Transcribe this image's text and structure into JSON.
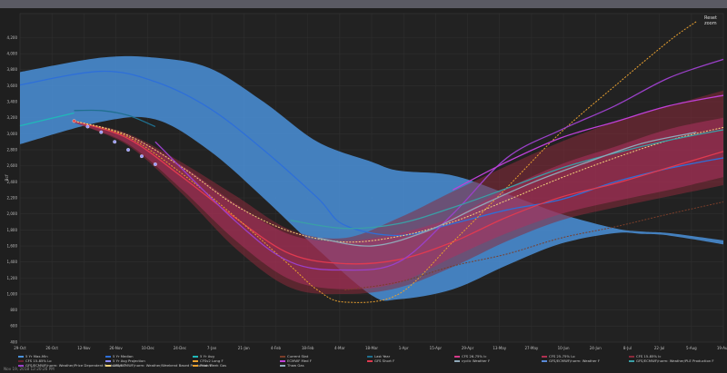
{
  "chart_data": {
    "type": "area",
    "ylabel": "Bcf",
    "y_ticks": [
      "400",
      "600",
      "800",
      "1,000",
      "1,200",
      "1,400",
      "1,600",
      "1,800",
      "2,000",
      "2,200",
      "2,400",
      "2,600",
      "2,800",
      "3,000",
      "3,200",
      "3,400",
      "3,600",
      "3,800",
      "4,000",
      "4,200"
    ],
    "x_ticks": [
      "29-Oct",
      "26-Oct",
      "12-Nov",
      "26-Nov",
      "10-Dec",
      "24-Dec",
      "7-Jan",
      "21-Jan",
      "4-Feb",
      "18-Feb",
      "4-Mar",
      "18-Mar",
      "1-Apr",
      "15-Apr",
      "29-Apr",
      "13-May",
      "27-May",
      "10-Jun",
      "24-Jun",
      "8-Jul",
      "22-Jul",
      "5-Aug",
      "19-Aug"
    ],
    "reset_zoom_label": "Reset zoom",
    "footer_text": "Nov 19, 2018 12:20:26 PM",
    "series": [
      {
        "name": "5 Yr Max-Min",
        "color": "#4a90d9",
        "kind": "band",
        "upper": [
          [
            0,
            3770
          ],
          [
            3,
            3950
          ],
          [
            5,
            3950
          ],
          [
            7,
            3820
          ],
          [
            9,
            3400
          ],
          [
            11,
            2900
          ],
          [
            13,
            2650
          ],
          [
            14,
            2540
          ],
          [
            16,
            2480
          ],
          [
            18,
            2250
          ],
          [
            20,
            2000
          ],
          [
            22,
            1820
          ],
          [
            23,
            1780
          ],
          [
            24,
            1760
          ],
          [
            26,
            1670
          ]
        ],
        "lower": [
          [
            0,
            2870
          ],
          [
            3,
            3150
          ],
          [
            5,
            3180
          ],
          [
            7,
            2790
          ],
          [
            9,
            2200
          ],
          [
            11,
            1560
          ],
          [
            13,
            985
          ],
          [
            14,
            935
          ],
          [
            16,
            1060
          ],
          [
            18,
            1360
          ],
          [
            20,
            1630
          ],
          [
            22,
            1760
          ],
          [
            23,
            1750
          ],
          [
            24,
            1730
          ],
          [
            26,
            1620
          ]
        ]
      },
      {
        "name": "5 Yr Avg",
        "color": "#2e6fd8",
        "points": [
          [
            0,
            3610
          ],
          [
            3,
            3780
          ],
          [
            5,
            3650
          ],
          [
            7,
            3320
          ],
          [
            9,
            2800
          ],
          [
            11,
            2200
          ],
          [
            12,
            1860
          ],
          [
            14,
            1730
          ],
          [
            16,
            1880
          ],
          [
            18,
            2050
          ],
          [
            20,
            2180
          ],
          [
            22,
            2400
          ],
          [
            24,
            2570
          ],
          [
            26,
            2700
          ]
        ]
      },
      {
        "name": "Last Year",
        "color": "#20b8b8",
        "points": [
          [
            0,
            3100
          ],
          [
            2,
            3260
          ]
        ]
      },
      {
        "name": "Current Year",
        "color": "#1f6f8f",
        "points": [
          [
            2,
            3290
          ],
          [
            3,
            3290
          ],
          [
            4,
            3230
          ],
          [
            5,
            3090
          ]
        ]
      },
      {
        "name": "CFS 26-75% Ic",
        "color": "#d63a8a",
        "kind": "band",
        "upper": [
          [
            2,
            3160
          ],
          [
            4,
            2980
          ],
          [
            6,
            2600
          ],
          [
            8,
            2120
          ],
          [
            10,
            1740
          ],
          [
            12,
            1660
          ],
          [
            14,
            1760
          ],
          [
            16,
            1960
          ],
          [
            18,
            2320
          ],
          [
            20,
            2620
          ],
          [
            22,
            2840
          ],
          [
            24,
            3060
          ],
          [
            26,
            3200
          ]
        ],
        "lower": [
          [
            2,
            3140
          ],
          [
            4,
            2870
          ],
          [
            6,
            2300
          ],
          [
            8,
            1660
          ],
          [
            10,
            1180
          ],
          [
            12,
            1060
          ],
          [
            14,
            1140
          ],
          [
            16,
            1460
          ],
          [
            18,
            1760
          ],
          [
            20,
            2000
          ],
          [
            22,
            2160
          ],
          [
            24,
            2300
          ],
          [
            26,
            2460
          ]
        ]
      },
      {
        "name": "CFS 15-85% Lo",
        "color": "#8b2a3a",
        "kind": "band",
        "upper": [
          [
            2,
            3160
          ],
          [
            4,
            3000
          ],
          [
            6,
            2640
          ],
          [
            8,
            2220
          ],
          [
            10,
            1800
          ],
          [
            12,
            1700
          ],
          [
            14,
            1950
          ],
          [
            16,
            2280
          ],
          [
            18,
            2600
          ],
          [
            20,
            2900
          ],
          [
            22,
            3150
          ],
          [
            24,
            3350
          ],
          [
            26,
            3540
          ]
        ],
        "lower": [
          [
            2,
            3140
          ],
          [
            4,
            2850
          ],
          [
            6,
            2250
          ],
          [
            8,
            1560
          ],
          [
            10,
            1080
          ],
          [
            12,
            1000
          ],
          [
            14,
            1080
          ],
          [
            16,
            1340
          ],
          [
            18,
            1660
          ],
          [
            20,
            1920
          ],
          [
            22,
            2080
          ],
          [
            24,
            2220
          ],
          [
            26,
            2360
          ]
        ]
      },
      {
        "name": "CFS Med",
        "color": "#e03a50",
        "points": [
          [
            2,
            3160
          ],
          [
            4,
            2940
          ],
          [
            6,
            2460
          ],
          [
            8,
            1940
          ],
          [
            10,
            1500
          ],
          [
            12,
            1380
          ],
          [
            14,
            1430
          ],
          [
            16,
            1650
          ],
          [
            18,
            1960
          ],
          [
            20,
            2210
          ],
          [
            22,
            2380
          ],
          [
            24,
            2580
          ],
          [
            26,
            2780
          ]
        ]
      },
      {
        "name": "CFSv2 Long",
        "color": "#e8a030",
        "points": [
          [
            2,
            3160
          ],
          [
            4,
            2960
          ],
          [
            6,
            2500
          ],
          [
            8,
            1950
          ],
          [
            10,
            1350
          ],
          [
            11,
            1050
          ],
          [
            12,
            900
          ],
          [
            14,
            1000
          ],
          [
            16,
            1650
          ],
          [
            18,
            2330
          ],
          [
            20,
            3020
          ],
          [
            22,
            3600
          ],
          [
            24,
            4160
          ],
          [
            25,
            4400
          ]
        ]
      },
      {
        "name": "Weather",
        "color": "#f2d27a",
        "points": [
          [
            2,
            3160
          ],
          [
            4,
            2980
          ],
          [
            6,
            2580
          ],
          [
            8,
            2100
          ],
          [
            10,
            1780
          ],
          [
            12,
            1650
          ],
          [
            14,
            1720
          ],
          [
            16,
            1900
          ],
          [
            18,
            2170
          ],
          [
            20,
            2450
          ],
          [
            22,
            2700
          ],
          [
            24,
            2920
          ],
          [
            26,
            3080
          ]
        ]
      },
      {
        "name": "Price Dependent Production",
        "color": "#9a40c8",
        "points": [
          [
            5,
            2900
          ],
          [
            8,
            1900
          ],
          [
            10,
            1400
          ],
          [
            12,
            1300
          ],
          [
            14,
            1400
          ],
          [
            16,
            2000
          ],
          [
            18,
            2700
          ],
          [
            20,
            3050
          ],
          [
            22,
            3350
          ],
          [
            24,
            3700
          ],
          [
            26,
            3930
          ]
        ]
      },
      {
        "name": "Current Stat",
        "color": "#7a3e2a",
        "points": [
          [
            12,
            1050
          ],
          [
            14,
            1150
          ],
          [
            16,
            1350
          ],
          [
            18,
            1500
          ],
          [
            20,
            1700
          ],
          [
            22,
            1840
          ],
          [
            24,
            2000
          ],
          [
            26,
            2150
          ]
        ]
      },
      {
        "name": "ECMWF Med",
        "color": "#c040d8",
        "points": [
          [
            16,
            2300
          ],
          [
            18,
            2650
          ],
          [
            20,
            2950
          ],
          [
            22,
            3150
          ],
          [
            24,
            3350
          ],
          [
            26,
            3480
          ]
        ]
      },
      {
        "name": "WeatherTX Production",
        "color": "#3a9fa6",
        "points": [
          [
            10,
            1920
          ],
          [
            12,
            1820
          ],
          [
            14,
            1880
          ],
          [
            16,
            2080
          ],
          [
            18,
            2320
          ],
          [
            20,
            2570
          ],
          [
            22,
            2760
          ],
          [
            24,
            2920
          ],
          [
            26,
            3050
          ]
        ]
      },
      {
        "name": "Thaw Gas",
        "color": "#90a8b8",
        "points": [
          [
            11,
            1700
          ],
          [
            13,
            1600
          ],
          [
            15,
            1780
          ],
          [
            17,
            2100
          ],
          [
            19,
            2400
          ],
          [
            21,
            2650
          ],
          [
            23,
            2880
          ],
          [
            25,
            3020
          ]
        ]
      }
    ],
    "markers": {
      "series": "5 Yr Avg Projection",
      "color": "#8a8aff",
      "points": [
        [
          2,
          3160
        ],
        [
          2.5,
          3090
        ],
        [
          3,
          3020
        ],
        [
          3.5,
          2900
        ],
        [
          4,
          2800
        ],
        [
          4.5,
          2720
        ],
        [
          5,
          2620
        ]
      ]
    },
    "x_range": [
      0,
      26
    ],
    "y_range": [
      400,
      4500
    ],
    "legend_position": "bottom"
  },
  "legend": [
    {
      "label": "5 Yr Max-Min",
      "color": "#4a90d9"
    },
    {
      "label": "5 Yr Median",
      "color": "#2e6fd8"
    },
    {
      "label": "5 Yr Avg",
      "color": "#20b8b8"
    },
    {
      "label": "Current Stat",
      "color": "#7a3e2a"
    },
    {
      "label": "Last Year",
      "color": "#1f6f8f"
    },
    {
      "label": "CFS 26-75% Ic",
      "color": "#d63a8a"
    },
    {
      "label": "CFS 25-75% Lo",
      "color": "#b03050"
    },
    {
      "label": "CFS 15-85% Ic",
      "color": "#8b2a3a"
    },
    {
      "label": "CFS 15-85% Lo",
      "color": "#6a2030"
    },
    {
      "label": "5 Yr Avg Projection",
      "color": "#8a8aff"
    },
    {
      "label": "CFSv2 Long F",
      "color": "#e8a030"
    },
    {
      "label": "ECMWF Med F",
      "color": "#c040d8"
    },
    {
      "label": "GFS Short F",
      "color": "#e03a50"
    },
    {
      "label": "cyclic Weather F",
      "color": "#90a8b8"
    },
    {
      "label": "GFS/ECMWF/norm: Weather F",
      "color": "#5a8ad8"
    },
    {
      "label": "GFS/ECMWF/norm: Weather/PLE Production F",
      "color": "#3a9fa6"
    },
    {
      "label": "GFS/ECMWF/norm: Weather/Price Dependent Production F",
      "color": "#9a40c8"
    },
    {
      "label": "GFS/ECMWF/norm: Weather/Weekend Based Production F",
      "color": "#f2d27a"
    },
    {
      "label": "Peak Week Gas",
      "color": "#e8a030"
    },
    {
      "label": "Thaw Gas",
      "color": "#90a8b8"
    }
  ]
}
